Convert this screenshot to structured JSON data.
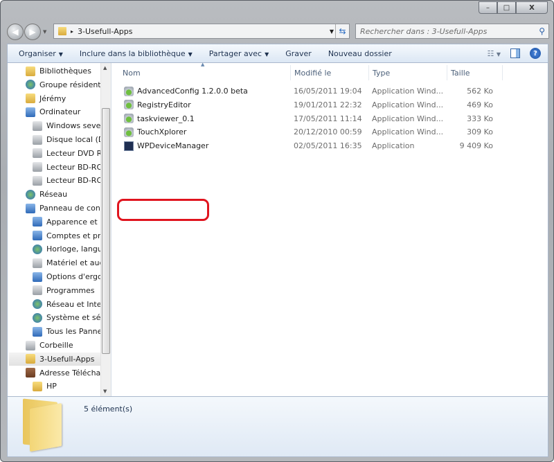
{
  "window": {
    "minimize": "–",
    "maximize": "□",
    "close": "X"
  },
  "address": {
    "path": "3-Usefull-Apps",
    "separator": "▸"
  },
  "search": {
    "placeholder": "Rechercher dans : 3-Usefull-Apps"
  },
  "toolbar": {
    "items": [
      {
        "label": "Organiser",
        "dropdown": true
      },
      {
        "label": "Inclure dans la bibliothèque",
        "dropdown": true
      },
      {
        "label": "Partager avec",
        "dropdown": true
      },
      {
        "label": "Graver",
        "dropdown": false
      },
      {
        "label": "Nouveau dossier",
        "dropdown": false
      }
    ]
  },
  "sidebar": {
    "items": [
      {
        "label": "Bibliothèques",
        "icon": "libraries-icon",
        "level": 1
      },
      {
        "label": "Groupe résidentiel",
        "icon": "homegroup-icon",
        "level": 1
      },
      {
        "label": "Jérémy",
        "icon": "user-folder-icon",
        "level": 1
      },
      {
        "label": "Ordinateur",
        "icon": "computer-icon",
        "level": 1
      },
      {
        "label": "Windows seven",
        "icon": "drive-icon",
        "level": 2
      },
      {
        "label": "Disque local (D:)",
        "icon": "drive-icon",
        "level": 2
      },
      {
        "label": "Lecteur DVD RW",
        "icon": "dvd-drive-icon",
        "level": 2
      },
      {
        "label": "Lecteur BD-ROM",
        "icon": "bd-drive-icon",
        "level": 2
      },
      {
        "label": "Lecteur BD-ROM",
        "icon": "bd-drive-icon",
        "level": 2
      },
      {
        "label": "Réseau",
        "icon": "network-icon",
        "level": 1
      },
      {
        "label": "Panneau de configuration",
        "icon": "control-panel-icon",
        "level": 1
      },
      {
        "label": "Apparence et personnalisation",
        "icon": "appearance-icon",
        "level": 2
      },
      {
        "label": "Comptes et protection",
        "icon": "accounts-icon",
        "level": 2
      },
      {
        "label": "Horloge, langue",
        "icon": "clock-icon",
        "level": 2
      },
      {
        "label": "Matériel et audio",
        "icon": "hardware-icon",
        "level": 2
      },
      {
        "label": "Options d'ergonomie",
        "icon": "ease-of-access-icon",
        "level": 2
      },
      {
        "label": "Programmes",
        "icon": "programs-icon",
        "level": 2
      },
      {
        "label": "Réseau et Internet",
        "icon": "network-internet-icon",
        "level": 2
      },
      {
        "label": "Système et sécurité",
        "icon": "security-icon",
        "level": 2
      },
      {
        "label": "Tous les Panneaux",
        "icon": "all-panels-icon",
        "level": 2
      },
      {
        "label": "Corbeille",
        "icon": "recycle-bin-icon",
        "level": 1
      },
      {
        "label": "3-Usefull-Apps",
        "icon": "folder-icon",
        "level": 1,
        "selected": true
      },
      {
        "label": "Adresse Téléchargement",
        "icon": "downloads-icon",
        "level": 1
      },
      {
        "label": "HP",
        "icon": "folder-icon",
        "level": 2
      }
    ]
  },
  "columns": {
    "name": "Nom",
    "modified": "Modifié le",
    "type": "Type",
    "size": "Taille"
  },
  "files": [
    {
      "name": "AdvancedConfig 1.2.0.0 beta",
      "modified": "16/05/2011 19:04",
      "type": "Application Wind...",
      "size": "562 Ko",
      "icon": "app-icon"
    },
    {
      "name": "RegistryEditor",
      "modified": "19/01/2011 22:32",
      "type": "Application Wind...",
      "size": "469 Ko",
      "icon": "app-icon"
    },
    {
      "name": "taskviewer_0.1",
      "modified": "17/05/2011 11:14",
      "type": "Application Wind...",
      "size": "333 Ko",
      "icon": "app-icon"
    },
    {
      "name": "TouchXplorer",
      "modified": "20/12/2010 00:59",
      "type": "Application Wind...",
      "size": "309 Ko",
      "icon": "app-icon"
    },
    {
      "name": "WPDeviceManager",
      "modified": "02/05/2011 16:35",
      "type": "Application",
      "size": "9 409 Ko",
      "icon": "wp-device-manager-icon",
      "highlighted": true
    }
  ],
  "highlight_color": "#e0141e",
  "status": {
    "count": "5 élément(s)"
  }
}
